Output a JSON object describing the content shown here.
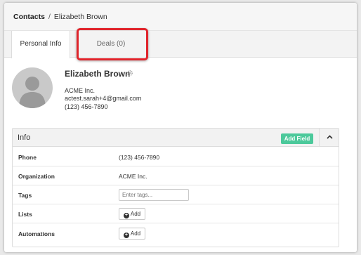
{
  "breadcrumb": {
    "root": "Contacts",
    "separator": "/",
    "current": "Elizabeth Brown"
  },
  "tabs": [
    {
      "label": "Personal Info",
      "active": true
    },
    {
      "label": "Deals (0)",
      "active": false,
      "highlighted": true
    }
  ],
  "contact": {
    "name": "Elizabeth Brown",
    "company": "ACME Inc.",
    "email": "actest.sarah+4@gmail.com",
    "phone": "(123) 456-7890"
  },
  "info_panel": {
    "title": "Info",
    "add_field_label": "Add Field",
    "rows": [
      {
        "label": "Phone",
        "value": "(123) 456-7890"
      },
      {
        "label": "Organization",
        "value": "ACME Inc."
      },
      {
        "label": "Tags",
        "placeholder": "Enter tags..."
      },
      {
        "label": "Lists",
        "button": "Add"
      },
      {
        "label": "Automations",
        "button": "Add"
      }
    ]
  },
  "colors": {
    "highlight": "#e0242b",
    "add_field": "#4cc99b"
  }
}
